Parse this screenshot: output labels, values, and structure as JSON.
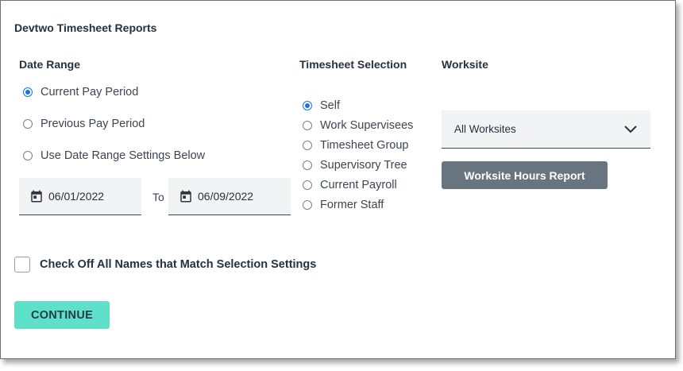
{
  "title": "Devtwo Timesheet Reports",
  "date_range": {
    "label": "Date Range",
    "options": [
      {
        "label": "Current Pay Period",
        "checked": true
      },
      {
        "label": "Previous Pay Period",
        "checked": false
      },
      {
        "label": "Use Date Range Settings Below",
        "checked": false
      }
    ],
    "from_date": "06/01/2022",
    "to_label": "To",
    "to_date": "06/09/2022"
  },
  "timesheet_selection": {
    "label": "Timesheet Selection",
    "options": [
      {
        "label": "Self",
        "checked": true
      },
      {
        "label": "Work Supervisees",
        "checked": false
      },
      {
        "label": "Timesheet Group",
        "checked": false
      },
      {
        "label": "Supervisory Tree",
        "checked": false
      },
      {
        "label": "Current Payroll",
        "checked": false
      },
      {
        "label": "Former Staff",
        "checked": false
      }
    ]
  },
  "worksite": {
    "label": "Worksite",
    "selected": "All Worksites",
    "report_button": "Worksite Hours Report"
  },
  "check_off_label": "Check Off All Names that Match Selection Settings",
  "continue_label": "CONTINUE",
  "colors": {
    "accent": "#1a73e8",
    "continue_bg": "#5fe0c8",
    "report_bg": "#68747f",
    "field_bg": "#f1f3f4"
  }
}
